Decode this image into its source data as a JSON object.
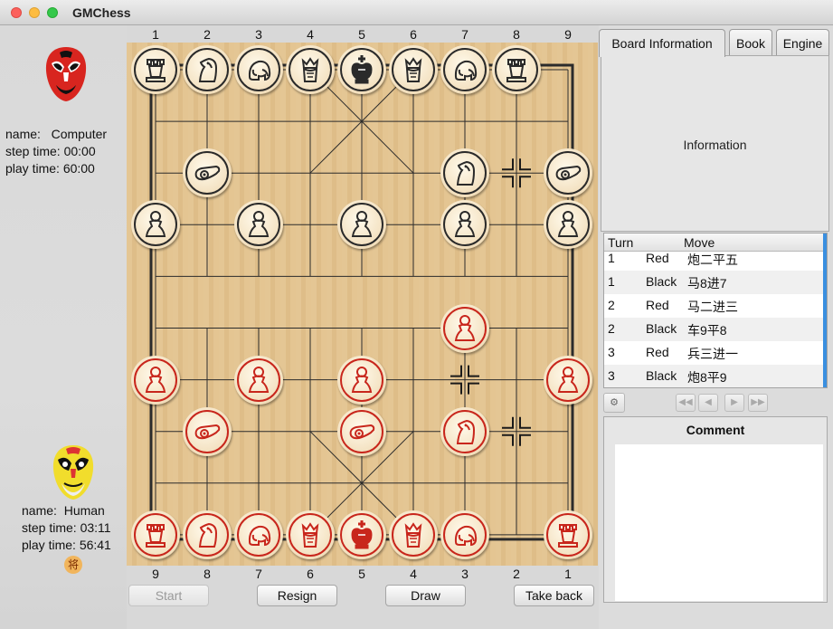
{
  "window": {
    "title": "GMChess"
  },
  "top_player": {
    "name_label": "name:",
    "name": "Computer",
    "step_label": "step time:",
    "step_time": "00:00",
    "play_label": "play time:",
    "play_time": "60:00"
  },
  "bottom_player": {
    "name_label": "name:",
    "name": "Human",
    "step_label": "step time:",
    "step_time": "03:11",
    "play_label": "play time:",
    "play_time": "56:41",
    "turn_badge": "将"
  },
  "board": {
    "top_files": [
      "1",
      "2",
      "3",
      "4",
      "5",
      "6",
      "7",
      "8",
      "9"
    ],
    "bottom_files": [
      "9",
      "8",
      "7",
      "6",
      "5",
      "4",
      "3",
      "2",
      "1"
    ],
    "pieces": [
      {
        "side": "black",
        "type": "rook",
        "file": 1,
        "rank": 0
      },
      {
        "side": "black",
        "type": "horse",
        "file": 2,
        "rank": 0
      },
      {
        "side": "black",
        "type": "elephant",
        "file": 3,
        "rank": 0
      },
      {
        "side": "black",
        "type": "advisor",
        "file": 4,
        "rank": 0
      },
      {
        "side": "black",
        "type": "king",
        "file": 5,
        "rank": 0
      },
      {
        "side": "black",
        "type": "advisor",
        "file": 6,
        "rank": 0
      },
      {
        "side": "black",
        "type": "elephant",
        "file": 7,
        "rank": 0
      },
      {
        "side": "black",
        "type": "rook",
        "file": 8,
        "rank": 0
      },
      {
        "side": "black",
        "type": "cannon",
        "file": 2,
        "rank": 2
      },
      {
        "side": "black",
        "type": "horse",
        "file": 7,
        "rank": 2
      },
      {
        "side": "black",
        "type": "cannon",
        "file": 9,
        "rank": 2
      },
      {
        "side": "black",
        "type": "pawn",
        "file": 1,
        "rank": 3
      },
      {
        "side": "black",
        "type": "pawn",
        "file": 3,
        "rank": 3
      },
      {
        "side": "black",
        "type": "pawn",
        "file": 5,
        "rank": 3
      },
      {
        "side": "black",
        "type": "pawn",
        "file": 7,
        "rank": 3
      },
      {
        "side": "black",
        "type": "pawn",
        "file": 9,
        "rank": 3
      },
      {
        "side": "red",
        "type": "pawn",
        "file": 7,
        "rank": 5
      },
      {
        "side": "red",
        "type": "pawn",
        "file": 1,
        "rank": 6
      },
      {
        "side": "red",
        "type": "pawn",
        "file": 3,
        "rank": 6
      },
      {
        "side": "red",
        "type": "pawn",
        "file": 5,
        "rank": 6
      },
      {
        "side": "red",
        "type": "pawn",
        "file": 9,
        "rank": 6
      },
      {
        "side": "red",
        "type": "cannon",
        "file": 2,
        "rank": 7
      },
      {
        "side": "red",
        "type": "cannon",
        "file": 5,
        "rank": 7
      },
      {
        "side": "red",
        "type": "horse",
        "file": 7,
        "rank": 7
      },
      {
        "side": "red",
        "type": "rook",
        "file": 1,
        "rank": 9
      },
      {
        "side": "red",
        "type": "horse",
        "file": 2,
        "rank": 9
      },
      {
        "side": "red",
        "type": "elephant",
        "file": 3,
        "rank": 9
      },
      {
        "side": "red",
        "type": "advisor",
        "file": 4,
        "rank": 9
      },
      {
        "side": "red",
        "type": "king",
        "file": 5,
        "rank": 9
      },
      {
        "side": "red",
        "type": "advisor",
        "file": 6,
        "rank": 9
      },
      {
        "side": "red",
        "type": "elephant",
        "file": 7,
        "rank": 9
      },
      {
        "side": "red",
        "type": "rook",
        "file": 9,
        "rank": 9
      }
    ],
    "move_markers": [
      {
        "file": 8,
        "rank": 2
      },
      {
        "file": 7,
        "rank": 6
      },
      {
        "file": 8,
        "rank": 7
      }
    ],
    "colors": {
      "board": "#e3c38e",
      "line": "#2b2b2b",
      "red": "#c8261c",
      "black": "#2a2a2a"
    }
  },
  "tabs": [
    {
      "label": "Board Information"
    },
    {
      "label": "Book"
    },
    {
      "label": "Engine"
    }
  ],
  "info_panel": {
    "text": "Information"
  },
  "moves_table": {
    "headers": {
      "turn": "Turn",
      "move": "Move"
    },
    "rows": [
      {
        "turn": "1",
        "side": "Red",
        "move": "炮二平五"
      },
      {
        "turn": "1",
        "side": "Black",
        "move": "马8进7"
      },
      {
        "turn": "2",
        "side": "Red",
        "move": "马二进三"
      },
      {
        "turn": "2",
        "side": "Black",
        "move": "车9平8"
      },
      {
        "turn": "3",
        "side": "Red",
        "move": "兵三进一"
      },
      {
        "turn": "3",
        "side": "Black",
        "move": "炮8平9"
      }
    ]
  },
  "nav": {
    "buttons": [
      "first-move",
      "prev-move",
      "next-move",
      "last-move"
    ]
  },
  "comment": {
    "title": "Comment",
    "text": ""
  },
  "buttons": {
    "start": "Start",
    "resign": "Resign",
    "draw": "Draw",
    "take_back": "Take back"
  }
}
